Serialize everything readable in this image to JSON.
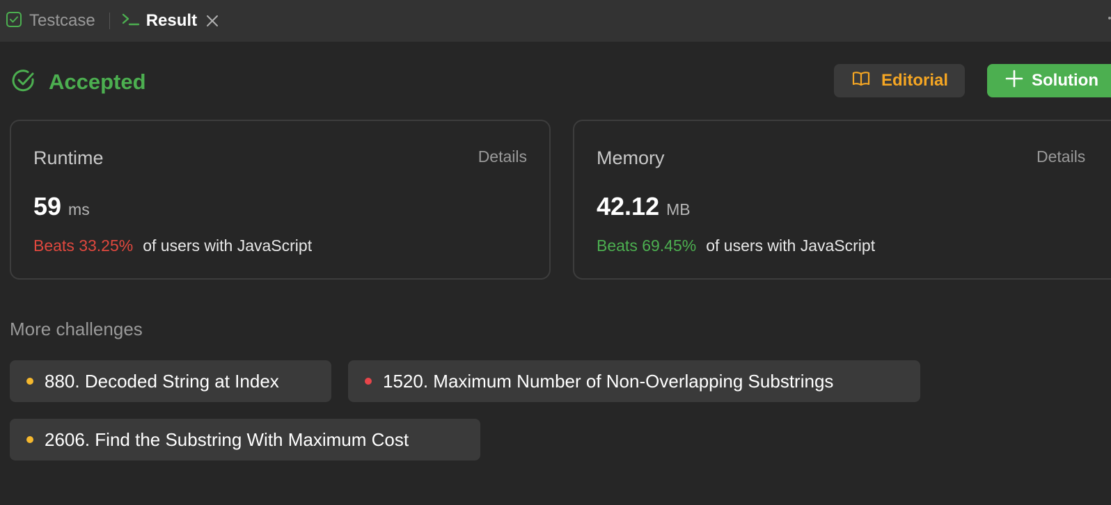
{
  "tabs": {
    "testcase_label": "Testcase",
    "result_label": "Result"
  },
  "status": {
    "title": "Accepted"
  },
  "actions": {
    "editorial_label": "Editorial",
    "solution_label": "Solution"
  },
  "runtime": {
    "title": "Runtime",
    "details_label": "Details",
    "value": "59",
    "unit": "ms",
    "beats": "Beats 33.25%",
    "suffix": "of users with JavaScript"
  },
  "memory": {
    "title": "Memory",
    "details_label": "Details",
    "value": "42.12",
    "unit": "MB",
    "beats": "Beats 69.45%",
    "suffix": "of users with JavaScript"
  },
  "more_challenges": {
    "title": "More challenges",
    "items": [
      {
        "label": "880. Decoded String at Index",
        "difficulty_color": "#f5b82e"
      },
      {
        "label": "1520. Maximum Number of Non-Overlapping Substrings",
        "difficulty_color": "#e8454a"
      },
      {
        "label": "2606. Find the Substring With Maximum Cost",
        "difficulty_color": "#f5b82e"
      }
    ]
  },
  "colors": {
    "accent_green": "#4caf50",
    "editorial_orange": "#f5a623",
    "beats_red": "#e0483e"
  }
}
